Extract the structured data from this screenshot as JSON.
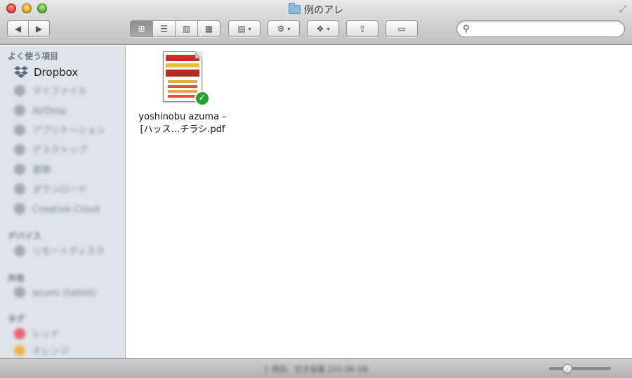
{
  "window": {
    "title": "例のアレ"
  },
  "toolbar": {
    "back_glyph": "◀",
    "forward_glyph": "▶",
    "view_icon_glyph": "⊞",
    "view_list_glyph": "☰",
    "view_column_glyph": "▥",
    "view_coverflow_glyph": "▦",
    "arrange_glyph": "▤",
    "action_glyph": "⚙",
    "dropbox_glyph": "❖",
    "share_glyph": "⇪",
    "tags_glyph": "▭",
    "caret_glyph": "▾"
  },
  "search": {
    "value": "",
    "placeholder": ""
  },
  "sidebar": {
    "favorites_header": "よく使う項目",
    "dropbox_label": "Dropbox",
    "blurred_items": [
      "マイファイル",
      "AirDrop",
      "アプリケーション",
      "デスクトップ",
      "書類",
      "ダウンロード",
      "Creative Cloud"
    ],
    "devices_header": "デバイス",
    "device_items": [
      "リモートディスク"
    ],
    "shared_header": "共有",
    "shared_items": [
      "azumi (tablet)"
    ],
    "tags_header": "タグ",
    "tag_items": [
      "レッド",
      "オレンジ"
    ]
  },
  "content": {
    "file": {
      "name_line1": "yoshinobu azuma –",
      "name_line2": "[ハッス…チラシ.pdf",
      "synced_glyph": "✓"
    }
  },
  "statusbar": {
    "text": "1 項目、空き容量 222.06 GB"
  },
  "icon_zoom": {
    "value": 0.25
  },
  "colors": {
    "sync_badge": "#2aa12a",
    "sidebar_bg": "#dfe4ea",
    "dropbox_blue": "#5b6b7c"
  }
}
